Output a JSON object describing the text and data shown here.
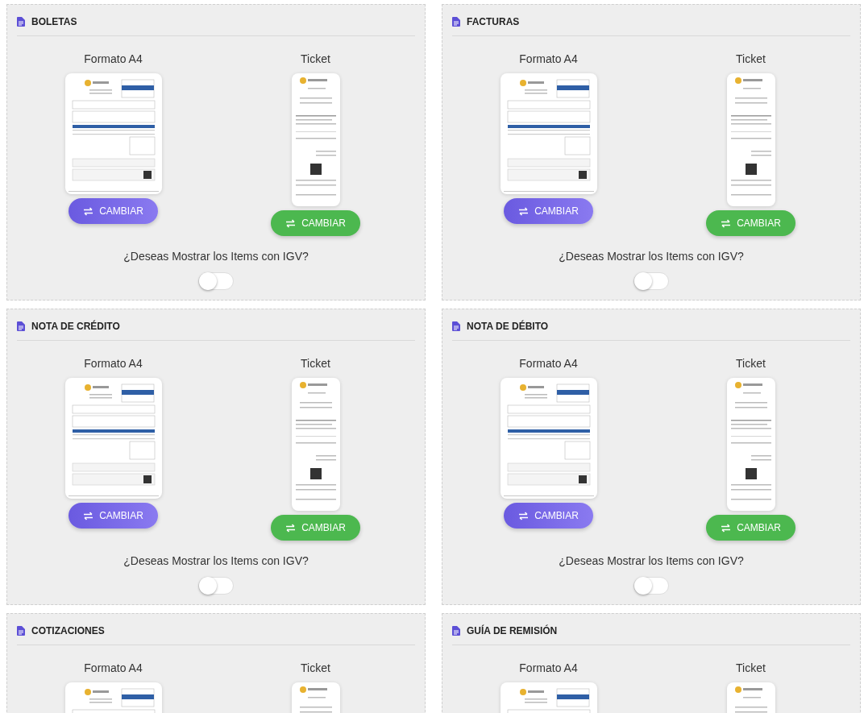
{
  "sections": [
    {
      "title": "BOLETAS",
      "formats": [
        {
          "label": "Formato A4",
          "kind": "a4",
          "button": "CAMBIAR"
        },
        {
          "label": "Ticket",
          "kind": "ticket",
          "button": "CAMBIAR"
        }
      ],
      "question": "¿Deseas Mostrar los Items con IGV?",
      "toggle": {
        "on": false
      }
    },
    {
      "title": "FACTURAS",
      "formats": [
        {
          "label": "Formato A4",
          "kind": "a4",
          "button": "CAMBIAR"
        },
        {
          "label": "Ticket",
          "kind": "ticket",
          "button": "CAMBIAR"
        }
      ],
      "question": "¿Deseas Mostrar los Items con IGV?",
      "toggle": {
        "on": false
      }
    },
    {
      "title": "NOTA DE CRÉDITO",
      "formats": [
        {
          "label": "Formato A4",
          "kind": "a4",
          "button": "CAMBIAR"
        },
        {
          "label": "Ticket",
          "kind": "ticket",
          "button": "CAMBIAR"
        }
      ],
      "question": "¿Deseas Mostrar los Items con IGV?",
      "toggle": {
        "on": false
      }
    },
    {
      "title": "NOTA DE DÉBITO",
      "formats": [
        {
          "label": "Formato A4",
          "kind": "a4",
          "button": "CAMBIAR"
        },
        {
          "label": "Ticket",
          "kind": "ticket",
          "button": "CAMBIAR"
        }
      ],
      "question": "¿Deseas Mostrar los Items con IGV?",
      "toggle": {
        "on": false
      }
    },
    {
      "title": "COTIZACIONES",
      "formats": [
        {
          "label": "Formato A4",
          "kind": "a4"
        },
        {
          "label": "Ticket",
          "kind": "ticket"
        }
      ]
    },
    {
      "title": "GUÍA DE REMISIÓN",
      "formats": [
        {
          "label": "Formato A4",
          "kind": "a4"
        },
        {
          "label": "Ticket",
          "kind": "ticket"
        }
      ]
    }
  ]
}
